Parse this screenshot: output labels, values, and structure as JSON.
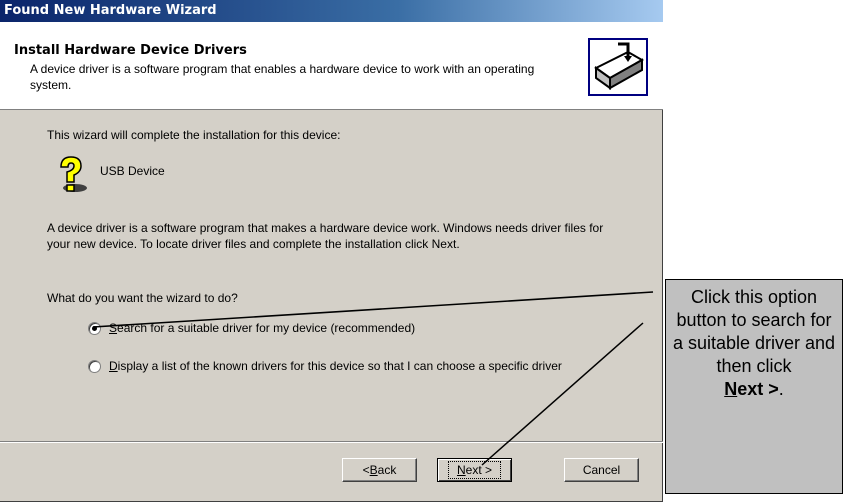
{
  "window": {
    "title": "Found New Hardware Wizard"
  },
  "header": {
    "title": "Install Hardware Device Drivers",
    "subtitle": "A device driver is a software program that enables a hardware device to work with an operating system.",
    "icon": "hardware-install-icon"
  },
  "body": {
    "intro": "This wizard will complete the installation for this device:",
    "device_icon": "unknown-device-icon",
    "device_name": "USB Device",
    "description": "A device driver is a software program that makes a hardware device work. Windows needs driver files for your new device. To locate driver files and complete the installation click Next.",
    "question": "What do you want the wizard to do?",
    "options": [
      {
        "accel": "S",
        "label_rest": "earch for a suitable driver for my device (recommended)",
        "selected": true
      },
      {
        "accel": "D",
        "label_rest": "isplay a list of the known drivers for this device so that I can choose a specific driver",
        "selected": false
      }
    ]
  },
  "buttons": {
    "back_prefix": "< ",
    "back_accel": "B",
    "back_rest": "ack",
    "next_accel": "N",
    "next_rest": "ext >",
    "cancel": "Cancel"
  },
  "callout": {
    "text": "Click this option button to search for a suitable driver and then click",
    "next_accel": "N",
    "next_rest": "ext >",
    "trailing": "."
  },
  "colors": {
    "titlebar_start": "#0a246a",
    "titlebar_end": "#a6caf0",
    "dialog_bg": "#d4d0c8",
    "callout_bg": "#c0c0c0"
  }
}
